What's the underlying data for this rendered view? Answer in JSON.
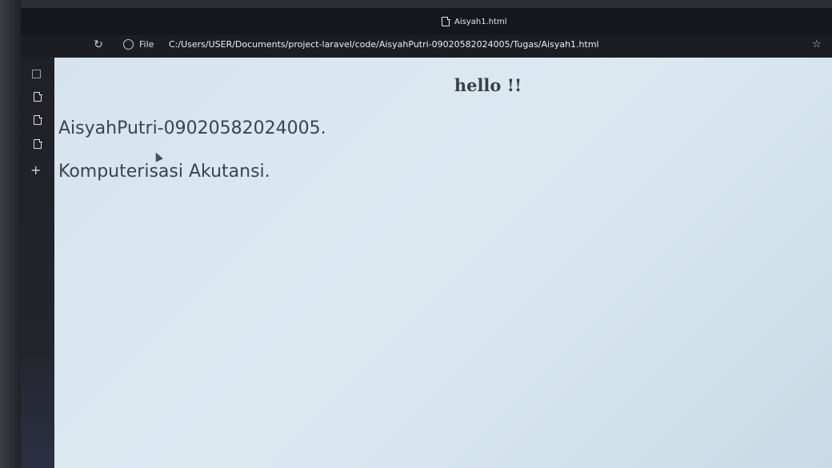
{
  "browser": {
    "tab_title": "Aisyah1.html",
    "scheme_label": "File",
    "address": "C:/Users/USER/Documents/project-laravel/code/AisyahPutri-09020582024005/Tugas/Aisyah1.html",
    "icons": {
      "tab": "document-icon",
      "reload": "reload-icon",
      "info": "info-icon",
      "favorite": "star-icon",
      "sidebar": [
        "tabs-icon",
        "document-icon",
        "document-icon",
        "document-icon",
        "plus-icon"
      ]
    }
  },
  "content": {
    "heading": "hello !!",
    "lines": [
      "AisyahPutri-09020582024005.",
      "Komputerisasi Akutansi."
    ]
  },
  "colors": {
    "chrome": "#15171c",
    "page_background": "#d6e3ee",
    "text": "#3c434c"
  }
}
